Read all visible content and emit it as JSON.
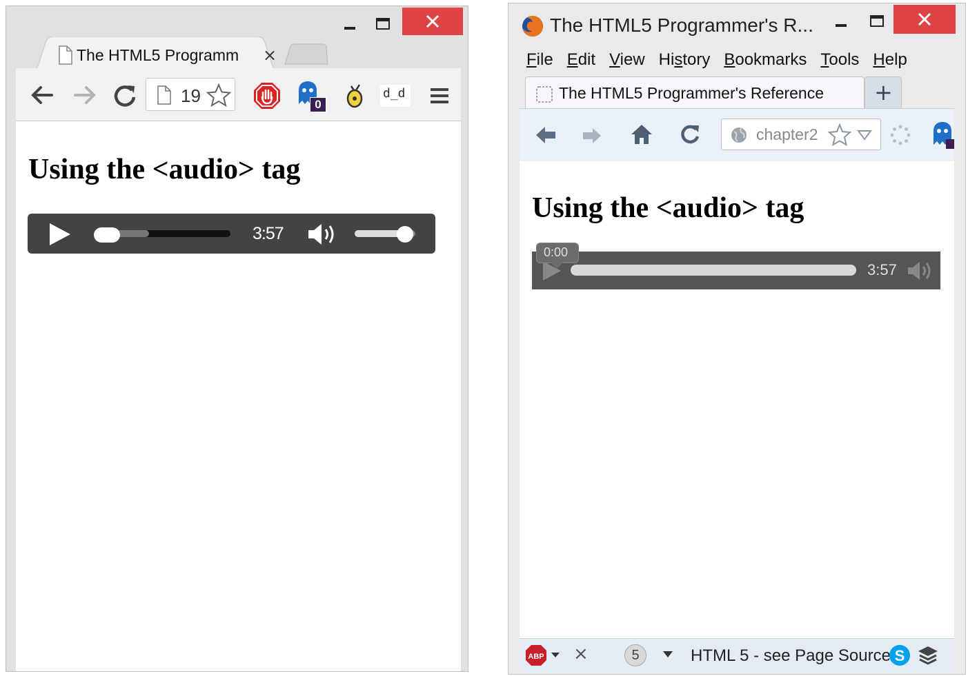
{
  "chrome": {
    "tab_title": "The HTML5 Programm",
    "tab_close": "×",
    "url_text": "19",
    "ext_badge": "0",
    "ext_face": "d_d",
    "page_heading": "Using the <audio> tag",
    "player_time": "3:57",
    "player_progress": 0.0,
    "player_volume": 0.9
  },
  "firefox": {
    "window_title": "The HTML5 Programmer's R...",
    "menu": [
      {
        "label": "File",
        "accel": "F",
        "rest": "ile"
      },
      {
        "label": "Edit",
        "accel": "E",
        "rest": "dit"
      },
      {
        "label": "View",
        "accel": "V",
        "rest": "iew"
      },
      {
        "label": "History",
        "accel_prefix": "Hi",
        "accel": "s",
        "rest": "tory"
      },
      {
        "label": "Bookmarks",
        "accel": "B",
        "rest": "ookmarks"
      },
      {
        "label": "Tools",
        "accel": "T",
        "rest": "ools"
      },
      {
        "label": "Help",
        "accel": "H",
        "rest": "elp"
      }
    ],
    "tab_title": "The HTML5 Programmer's Reference",
    "new_tab": "+",
    "url_text": "chapter2",
    "page_heading": "Using the <audio> tag",
    "player_current": "0:00",
    "player_time": "3:57",
    "player_progress": 0.0,
    "status_count": "5",
    "status_close": "×",
    "status_text": "HTML 5 - see Page Source"
  },
  "colors": {
    "close_red": "#e04343",
    "player_dark": "#434343",
    "firefox_player": "#555555",
    "firefox_chrome": "#e9f0f8"
  }
}
